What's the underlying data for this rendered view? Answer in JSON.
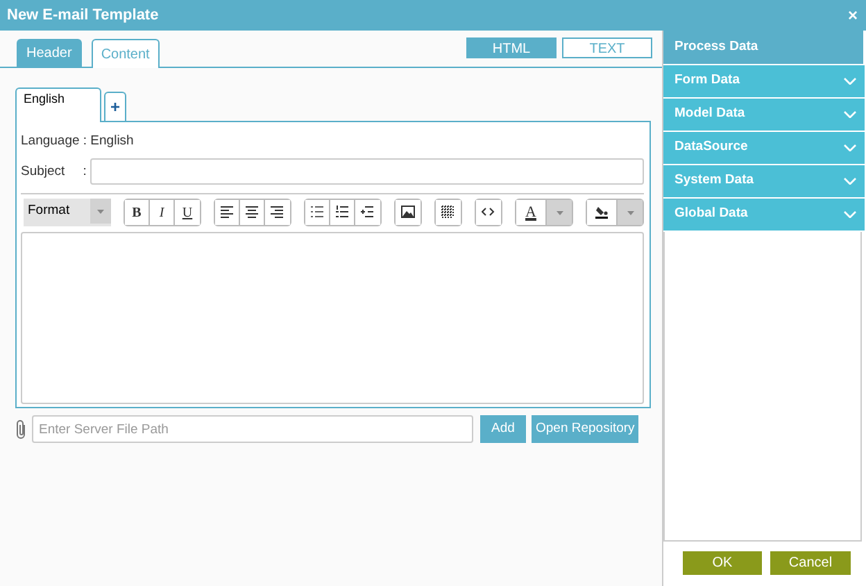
{
  "window": {
    "title": "New E-mail Template",
    "close": "×"
  },
  "tabs": [
    {
      "label": "Header",
      "selected": false
    },
    {
      "label": "Content",
      "selected": true
    }
  ],
  "mode_toggle": [
    {
      "label": "HTML",
      "selected": true
    },
    {
      "label": "TEXT",
      "selected": false
    }
  ],
  "language_tabs": [
    {
      "label": "English",
      "selected": true
    }
  ],
  "add_language": "+",
  "language_line": "Language : English",
  "subject": {
    "label": "Subject",
    "separator": ":"
  },
  "toolbar": {
    "format": "Format",
    "groups": [
      [
        {
          "kind": "bold",
          "label": "B"
        },
        {
          "kind": "italic",
          "label": "I"
        },
        {
          "kind": "underline",
          "label": "U"
        }
      ],
      [
        {
          "kind": "align-left"
        },
        {
          "kind": "align-center"
        },
        {
          "kind": "align-right"
        }
      ],
      [
        {
          "kind": "bullet-list"
        },
        {
          "kind": "numbered-list"
        },
        {
          "kind": "outdent"
        }
      ],
      [
        {
          "kind": "image"
        }
      ],
      [
        {
          "kind": "table"
        }
      ],
      [
        {
          "kind": "code"
        }
      ],
      [
        {
          "kind": "font-color",
          "label": "A"
        }
      ],
      [
        {
          "kind": "background-color"
        }
      ]
    ]
  },
  "attachment": {
    "placeholder": "Enter Server File Path",
    "buttons": [
      "Add",
      "Open Repository"
    ]
  },
  "side_panel": {
    "title": "Process Data",
    "sections": [
      {
        "label": "Form Data",
        "expanded": false
      },
      {
        "label": "Model Data",
        "expanded": false
      },
      {
        "label": "DataSource",
        "expanded": false
      },
      {
        "label": "System Data",
        "expanded": false
      },
      {
        "label": "Global Data",
        "expanded": false
      }
    ]
  },
  "footer_buttons": [
    "OK",
    "Cancel"
  ]
}
